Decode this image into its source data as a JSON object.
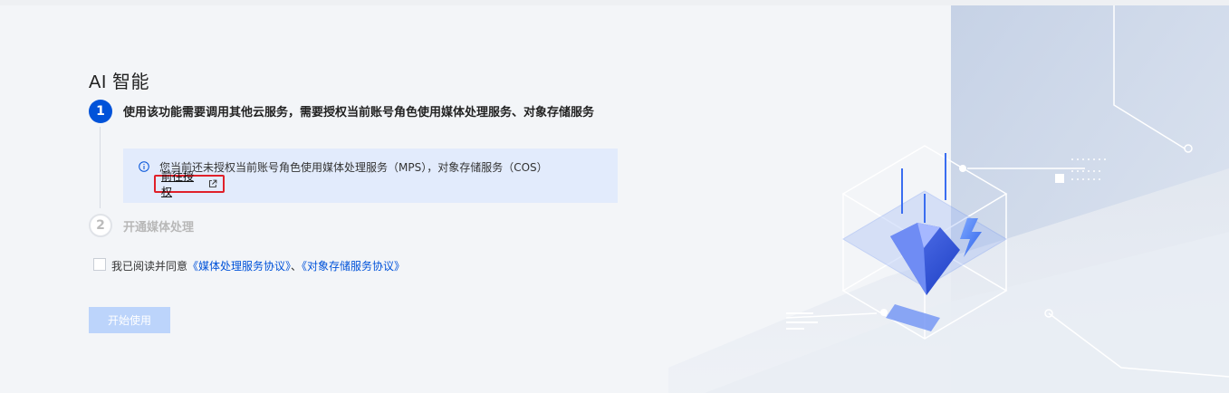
{
  "page": {
    "title": "AI 智能"
  },
  "steps": [
    {
      "number": "1",
      "label": "使用该功能需要调用其他云服务，需要授权当前账号角色使用媒体处理服务、对象存储服务",
      "state": "active"
    },
    {
      "number": "2",
      "label": "开通媒体处理",
      "state": "pending"
    }
  ],
  "notice": {
    "icon": "info-icon",
    "text": "您当前还未授权当前账号角色使用媒体处理服务（MPS），对象存储服务（COS）",
    "link_label": "前往授权",
    "link_icon": "external-link-icon"
  },
  "agreement": {
    "prefix": "我已阅读并同意",
    "link1": "《媒体处理服务协议》",
    "separator": "、",
    "link2": "《对象存储服务协议》",
    "checked": false
  },
  "actions": {
    "start_label": "开始使用"
  },
  "colors": {
    "primary": "#0052d9",
    "notice_bg": "#e2ebfc",
    "disabled_button": "#bcd4fb",
    "highlight_border": "#e0202a"
  }
}
